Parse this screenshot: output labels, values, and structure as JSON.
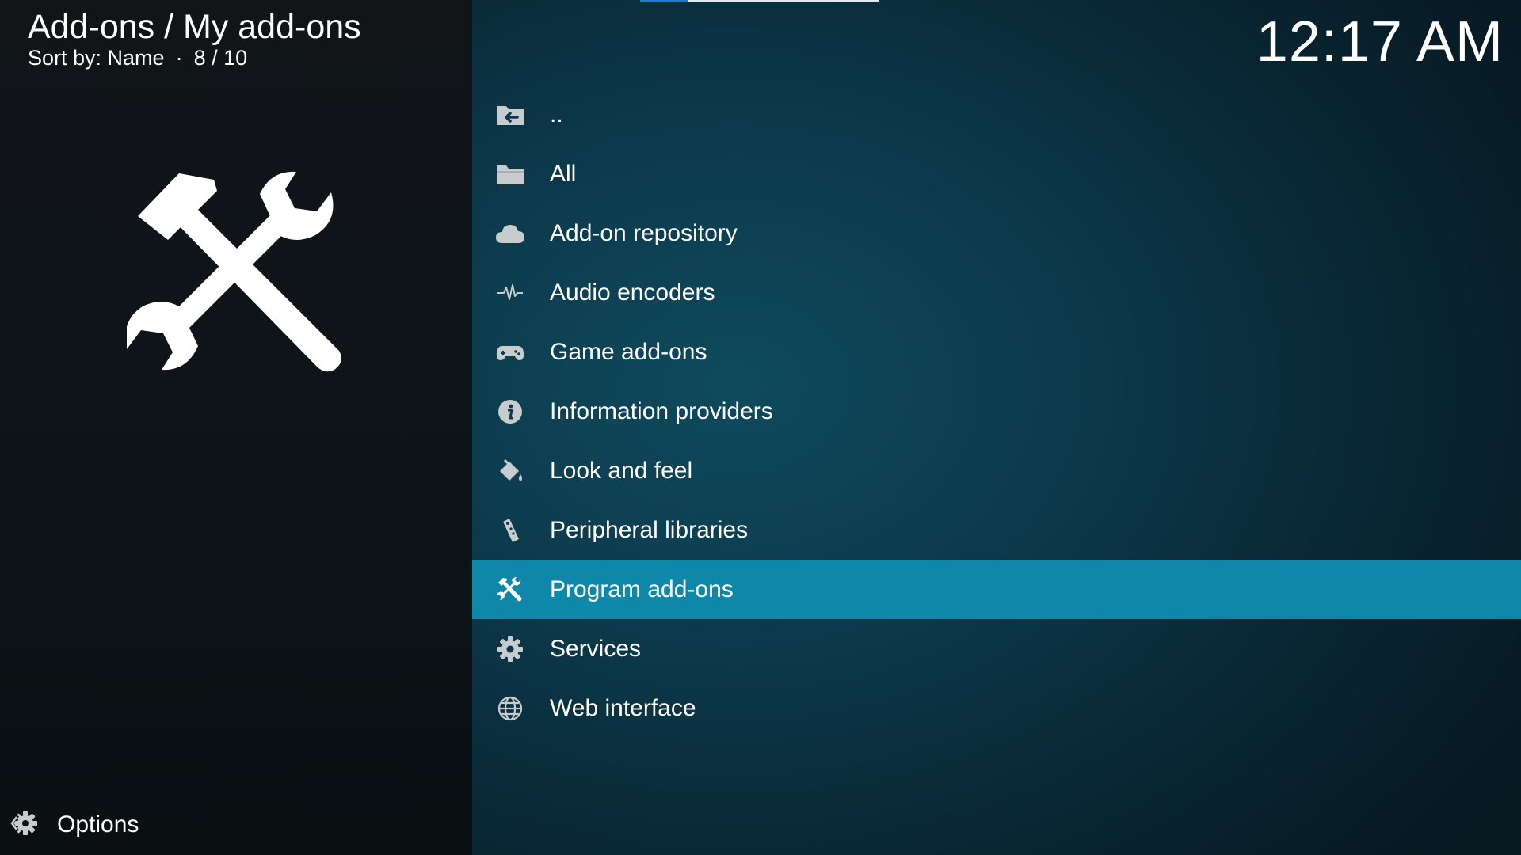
{
  "header": {
    "breadcrumb": "Add-ons / My add-ons",
    "sort_label": "Sort by: Name",
    "separator": "·",
    "position": "8 / 10"
  },
  "clock": "12:17 AM",
  "hero_icon": "tools-icon",
  "list": {
    "selected_index": 8,
    "items": [
      {
        "label": "..",
        "icon": "folder-back-icon"
      },
      {
        "label": "All",
        "icon": "folder-icon"
      },
      {
        "label": "Add-on repository",
        "icon": "cloud-icon"
      },
      {
        "label": "Audio encoders",
        "icon": "waveform-icon"
      },
      {
        "label": "Game add-ons",
        "icon": "gamepad-icon"
      },
      {
        "label": "Information providers",
        "icon": "info-icon"
      },
      {
        "label": "Look and feel",
        "icon": "paint-bucket-icon"
      },
      {
        "label": "Peripheral libraries",
        "icon": "remote-icon"
      },
      {
        "label": "Program add-ons",
        "icon": "tools-icon"
      },
      {
        "label": "Services",
        "icon": "gear-icon"
      },
      {
        "label": "Web interface",
        "icon": "globe-icon"
      }
    ]
  },
  "options": {
    "label": "Options",
    "icon": "options-icon"
  },
  "colors": {
    "selected_row": "#0f87a8",
    "sidebar_bg": "#111518",
    "main_bg": "#0c3a4c",
    "icon_gray": "#c8ccce"
  }
}
